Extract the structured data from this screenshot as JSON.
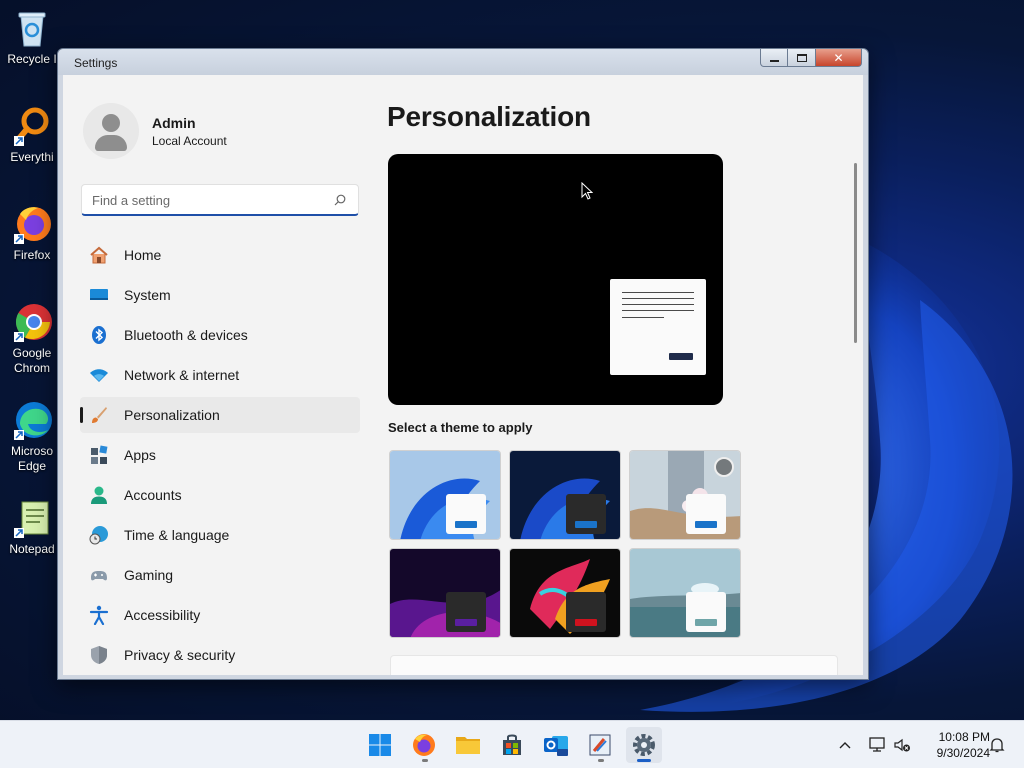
{
  "desktop": {
    "icons": [
      {
        "label": "Recycle I",
        "icon": "recycle-bin-icon"
      },
      {
        "label": "Everythi",
        "icon": "everything-search-icon"
      },
      {
        "label": "Firefox",
        "icon": "firefox-icon"
      },
      {
        "label": "Google\nChrom",
        "icon": "chrome-icon"
      },
      {
        "label": "Microso\nEdge",
        "icon": "edge-icon"
      },
      {
        "label": "Notepad",
        "icon": "notepad-icon"
      }
    ]
  },
  "window": {
    "title": "Settings",
    "min_label": "▁",
    "max_label": "▢",
    "close_label": "✕"
  },
  "user": {
    "name": "Admin",
    "account_type": "Local Account"
  },
  "search": {
    "placeholder": "Find a setting"
  },
  "nav": {
    "items": [
      {
        "label": "Home",
        "icon": "home-icon"
      },
      {
        "label": "System",
        "icon": "system-display-icon"
      },
      {
        "label": "Bluetooth & devices",
        "icon": "bluetooth-icon"
      },
      {
        "label": "Network & internet",
        "icon": "wifi-icon"
      },
      {
        "label": "Personalization",
        "icon": "paintbrush-icon",
        "active": true
      },
      {
        "label": "Apps",
        "icon": "apps-icon"
      },
      {
        "label": "Accounts",
        "icon": "person-icon"
      },
      {
        "label": "Time & language",
        "icon": "globe-clock-icon"
      },
      {
        "label": "Gaming",
        "icon": "gamepad-icon"
      },
      {
        "label": "Accessibility",
        "icon": "accessibility-icon"
      },
      {
        "label": "Privacy & security",
        "icon": "shield-icon"
      }
    ]
  },
  "main": {
    "title": "Personalization",
    "themes_label": "Select a theme to apply",
    "themes": [
      {
        "name": "windows-light",
        "accent": "#1a73c9"
      },
      {
        "name": "windows-dark",
        "accent": "#1a73c9"
      },
      {
        "name": "spotlight",
        "accent": "#1a73c9"
      },
      {
        "name": "glow",
        "accent": "#5a1fa0"
      },
      {
        "name": "captured-motion",
        "accent": "#d0121e"
      },
      {
        "name": "flow",
        "accent": "#6fa5a8"
      }
    ]
  },
  "taskbar": {
    "apps": [
      "start-icon",
      "firefox-icon",
      "file-explorer-icon",
      "store-icon",
      "outlook-icon",
      "paint-icon",
      "settings-icon"
    ],
    "tray": {
      "chevron": "^",
      "time": "10:08 PM",
      "date": "9/30/2024"
    }
  },
  "colors": {
    "accent": "#1e4fa8",
    "window_bg": "#f3f3f3",
    "taskbar_bg": "#eef2f8"
  }
}
